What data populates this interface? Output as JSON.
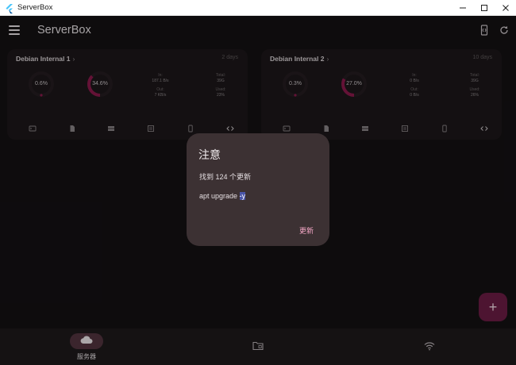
{
  "window": {
    "title": "ServerBox"
  },
  "appbar": {
    "title": "ServerBox"
  },
  "servers": [
    {
      "name": "Debian Internal 1",
      "uptime": "2 days",
      "cpu": "0.6%",
      "mem": "34.6%",
      "net": {
        "in_label": "In:",
        "in_value": "187.1 B/s",
        "out_label": "Out:",
        "out_value": "7 KB/s"
      },
      "disk": {
        "total_label": "Total:",
        "total_value": "39G",
        "used_label": "Used:",
        "used_value": "23%"
      }
    },
    {
      "name": "Debian Internal 2",
      "uptime": "10 days",
      "cpu": "0.3%",
      "mem": "27.0%",
      "net": {
        "in_label": "In:",
        "in_value": "0 B/s",
        "out_label": "Out:",
        "out_value": "0 B/s"
      },
      "disk": {
        "total_label": "Total:",
        "total_value": "39G",
        "used_label": "Used:",
        "used_value": "26%"
      }
    }
  ],
  "dialog": {
    "title": "注意",
    "message": "找到 124 个更新",
    "command_prefix": "apt upgrade ",
    "command_selected": "-y",
    "action_label": "更新"
  },
  "fab": {
    "label": "+"
  },
  "bottom_nav": {
    "items": [
      {
        "label": "服务器"
      }
    ]
  },
  "colors": {
    "background": "#141113",
    "card": "#1c1719",
    "accent": "#6b1d44",
    "gauge_arc": "#8b1a4c",
    "dialog": "#3c3133",
    "dialog_action": "#f4a7c6"
  }
}
